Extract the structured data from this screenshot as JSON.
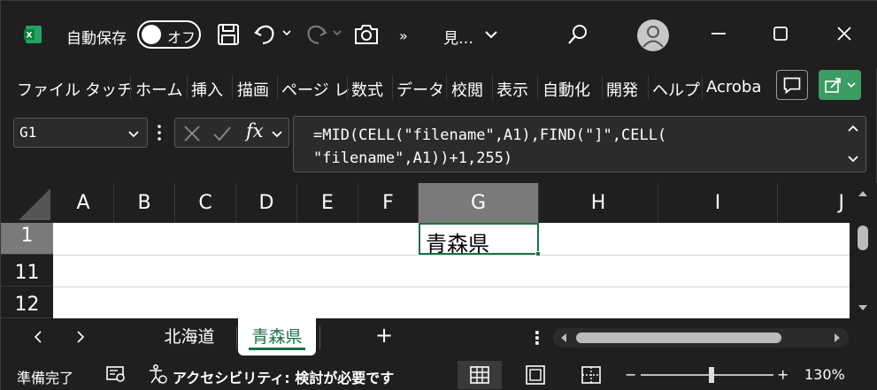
{
  "titlebar": {
    "autosave_label": "自動保存",
    "autosave_state": "オフ",
    "more": "»",
    "doc_title": "見…"
  },
  "ribbon": {
    "tabs": [
      "ファイル",
      "タッチ",
      "ホーム",
      "挿入",
      "描画",
      "ページ レ",
      "数式",
      "データ",
      "校閲",
      "表示",
      "自動化",
      "開発",
      "ヘルプ",
      "Acroba"
    ]
  },
  "formula_bar": {
    "name_box": "G1",
    "fx_label": "fx",
    "formula": "=MID(CELL(\"filename\",A1),FIND(\"]\",CELL(\n\"filename\",A1))+1,255)"
  },
  "grid": {
    "columns": [
      "A",
      "B",
      "C",
      "D",
      "E",
      "F",
      "G",
      "H",
      "I",
      "J"
    ],
    "selected_column": "G",
    "rows": [
      "1",
      "11",
      "12"
    ],
    "active_cell_value": "青森県"
  },
  "sheets": {
    "tabs": [
      "北海道",
      "青森県"
    ],
    "active": "青森県",
    "add": "+",
    "more": "⋮"
  },
  "status": {
    "ready": "準備完了",
    "accessibility": "アクセシビリティ: 検討が必要です",
    "zoom_minus": "−",
    "zoom_plus": "+",
    "zoom_level": "130%"
  },
  "colors": {
    "background": "#1f1f1f",
    "accent": "#1e7145",
    "share": "#3d9c63"
  }
}
